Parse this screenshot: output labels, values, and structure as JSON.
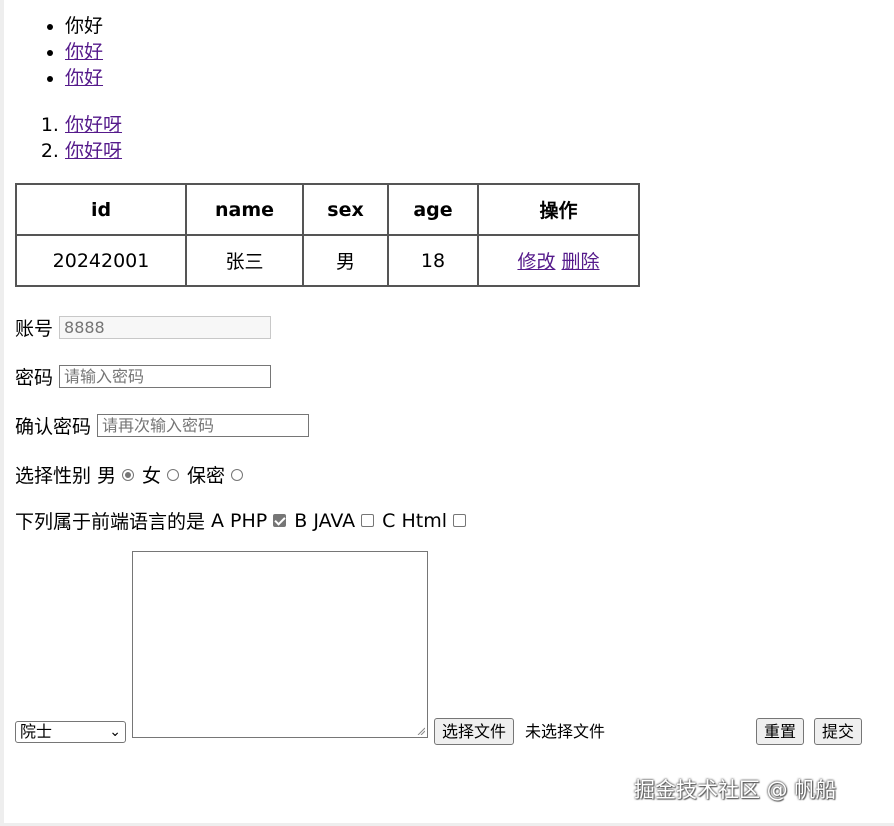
{
  "unordered_list": [
    "你好",
    "你好",
    "你好"
  ],
  "ordered_list": [
    "你好呀",
    "你好呀"
  ],
  "table": {
    "headers": [
      "id",
      "name",
      "sex",
      "age",
      "操作"
    ],
    "row": {
      "id": "20242001",
      "name": "张三",
      "sex": "男",
      "age": "18",
      "edit": "修改",
      "delete": "删除"
    }
  },
  "form": {
    "account_label": "账号",
    "account_placeholder": "8888",
    "password_label": "密码",
    "password_placeholder": "请输入密码",
    "confirm_label": "确认密码",
    "confirm_placeholder": "请再次输入密码",
    "gender_label": "选择性别",
    "gender_options": [
      "男",
      "女",
      "保密"
    ],
    "gender_selected": "男",
    "question_label": "下列属于前端语言的是",
    "question_options": [
      "A PHP",
      "B JAVA",
      "C Html"
    ],
    "question_checked": [
      "A PHP"
    ],
    "select_value": "院士",
    "file_button": "选择文件",
    "file_status": "未选择文件",
    "reset_button": "重置",
    "submit_button": "提交"
  },
  "watermark": "掘金技术社区 @ 帆船"
}
